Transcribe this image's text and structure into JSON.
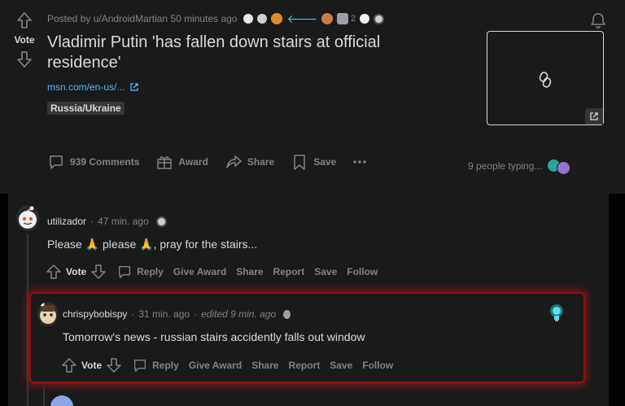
{
  "post": {
    "vote_label": "Vote",
    "meta_text": "Posted by u/AndroidMartian 50 minutes ago",
    "award_count": "2",
    "title": "Vladimir Putin 'has fallen down stairs at official residence'",
    "link": "msn.com/en-us/...",
    "flair": "Russia/Ukraine",
    "actions": {
      "comments": "939 Comments",
      "award": "Award",
      "share": "Share",
      "save": "Save"
    },
    "typing": "9 people typing..."
  },
  "comments": [
    {
      "user": "utilizador",
      "time": "47 min. ago",
      "body": "Please 🙏 please 🙏, pray for the stairs...",
      "actions": {
        "vote": "Vote",
        "reply": "Reply",
        "give_award": "Give Award",
        "share": "Share",
        "report": "Report",
        "save": "Save",
        "follow": "Follow"
      }
    },
    {
      "user": "chrispybobispy",
      "time": "31 min. ago",
      "edited": "edited 9 min. ago",
      "body": "Tomorrow's news - russian stairs accidently falls out window",
      "actions": {
        "vote": "Vote",
        "reply": "Reply",
        "give_award": "Give Award",
        "share": "Share",
        "report": "Report",
        "save": "Save",
        "follow": "Follow"
      }
    }
  ],
  "colors": {
    "background": "#030303",
    "card": "#1a1a1b",
    "text": "#d7dadc",
    "muted": "#818384",
    "link": "#4fbcff",
    "highlight_border": "#8b1313"
  },
  "icons": [
    "upvote-icon",
    "downvote-icon",
    "bell-icon",
    "link-icon",
    "external-link-icon",
    "comment-icon",
    "award-icon",
    "share-icon",
    "save-icon",
    "more-icon",
    "lightbulb-icon"
  ]
}
